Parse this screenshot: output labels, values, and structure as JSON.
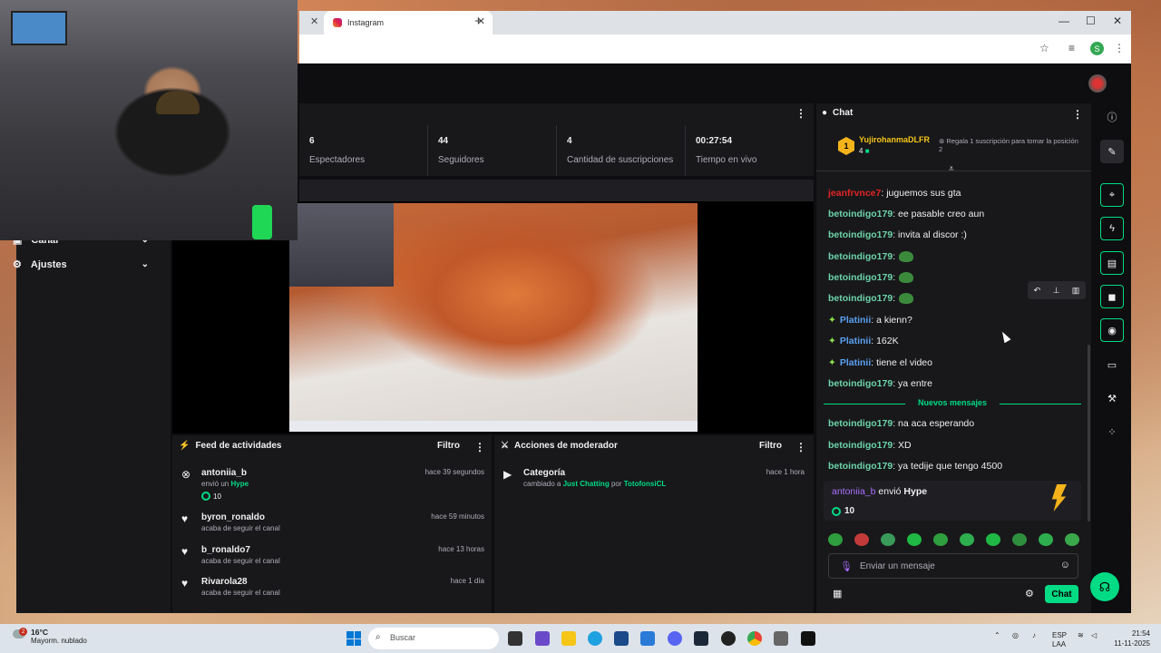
{
  "browser": {
    "tab_title": "Instagram",
    "close_glyph": "✕",
    "new_tab_glyph": "+",
    "profile_initial": "S"
  },
  "stats": {
    "items": [
      {
        "value": "6",
        "label": "Espectadores"
      },
      {
        "value": "44",
        "label": "Seguidores"
      },
      {
        "value": "4",
        "label": "Cantidad de suscripciones"
      },
      {
        "value": "00:27:54",
        "label": "Tiempo en vivo"
      }
    ]
  },
  "sidebar": {
    "items": [
      {
        "label": "Canal",
        "icon": "channel-icon"
      },
      {
        "label": "Ajustes",
        "icon": "gear-icon"
      }
    ]
  },
  "activity_feed": {
    "title": "Feed de actividades",
    "filter_label": "Filtro",
    "items": [
      {
        "user": "antoniia_b",
        "desc_prefix": "envió un",
        "desc_highlight": "Hype",
        "time": "hace 39 segundos",
        "amount": "10",
        "icon": "hype-icon"
      },
      {
        "user": "byron_ronaldo",
        "desc": "acaba de seguir el canal",
        "time": "hace 59 minutos",
        "icon": "heart-icon"
      },
      {
        "user": "b_ronaldo7",
        "desc": "acaba de seguir el canal",
        "time": "hace 13 horas",
        "icon": "heart-icon"
      },
      {
        "user": "Rivarola28",
        "desc": "acaba de seguir el canal",
        "time": "hace 1 día",
        "icon": "heart-icon"
      }
    ]
  },
  "mod_actions": {
    "title": "Acciones de moderador",
    "filter_label": "Filtro",
    "item": {
      "title": "Categoría",
      "desc_prefix": "cambiado a",
      "category": "Just Chatting",
      "by": "por",
      "moderator": "TotofonsiCL",
      "time": "hace 1 hora"
    }
  },
  "chat": {
    "title": "Chat",
    "pinned": {
      "rank": "1",
      "user": "YujirohanmaDLFR",
      "count": "4",
      "gift_note": "Regala 1 suscripción para tomar la posición 2"
    },
    "messages": [
      {
        "user": "jeanfrvnce7",
        "text": "juguemos sus gta",
        "color": "red"
      },
      {
        "user": "betoindigo179",
        "text": "ee pasable creo aun",
        "color": "green"
      },
      {
        "user": "betoindigo179",
        "text": "invita al discor :)",
        "color": "green"
      },
      {
        "user": "betoindigo179",
        "text": "",
        "emote": true,
        "color": "green"
      },
      {
        "user": "betoindigo179",
        "text": "",
        "emote": true,
        "color": "green"
      },
      {
        "user": "betoindigo179",
        "text": "",
        "emote": true,
        "color": "green"
      },
      {
        "user": "Platinii",
        "text": "a kienn?",
        "color": "blue",
        "badge": true
      },
      {
        "user": "Platinii",
        "text": "162K",
        "color": "blue",
        "badge": true
      },
      {
        "user": "Platinii",
        "text": "tiene el video",
        "color": "blue",
        "badge": true
      },
      {
        "user": "betoindigo179",
        "text": "ya entre",
        "color": "green"
      },
      {
        "user": "betoindigo179",
        "text": "na aca esperando",
        "color": "green"
      },
      {
        "user": "betoindigo179",
        "text": "XD",
        "color": "green"
      },
      {
        "user": "betoindigo179",
        "text": "ya tedije que tengo 4500",
        "color": "green"
      }
    ],
    "new_messages_label": "Nuevos mensajes",
    "hype": {
      "user": "antoniia_b",
      "action": "envió",
      "item": "Hype",
      "amount": "10"
    },
    "input_placeholder": "Enviar un mensaje",
    "send_label": "Chat"
  },
  "taskbar": {
    "temperature": "16°C",
    "weather": "Mayorm. nublado",
    "weather_badge": "2",
    "search_label": "Buscar",
    "lang_1": "ESP",
    "lang_2": "LAA",
    "time": "21:54",
    "date": "11-11-2025"
  }
}
